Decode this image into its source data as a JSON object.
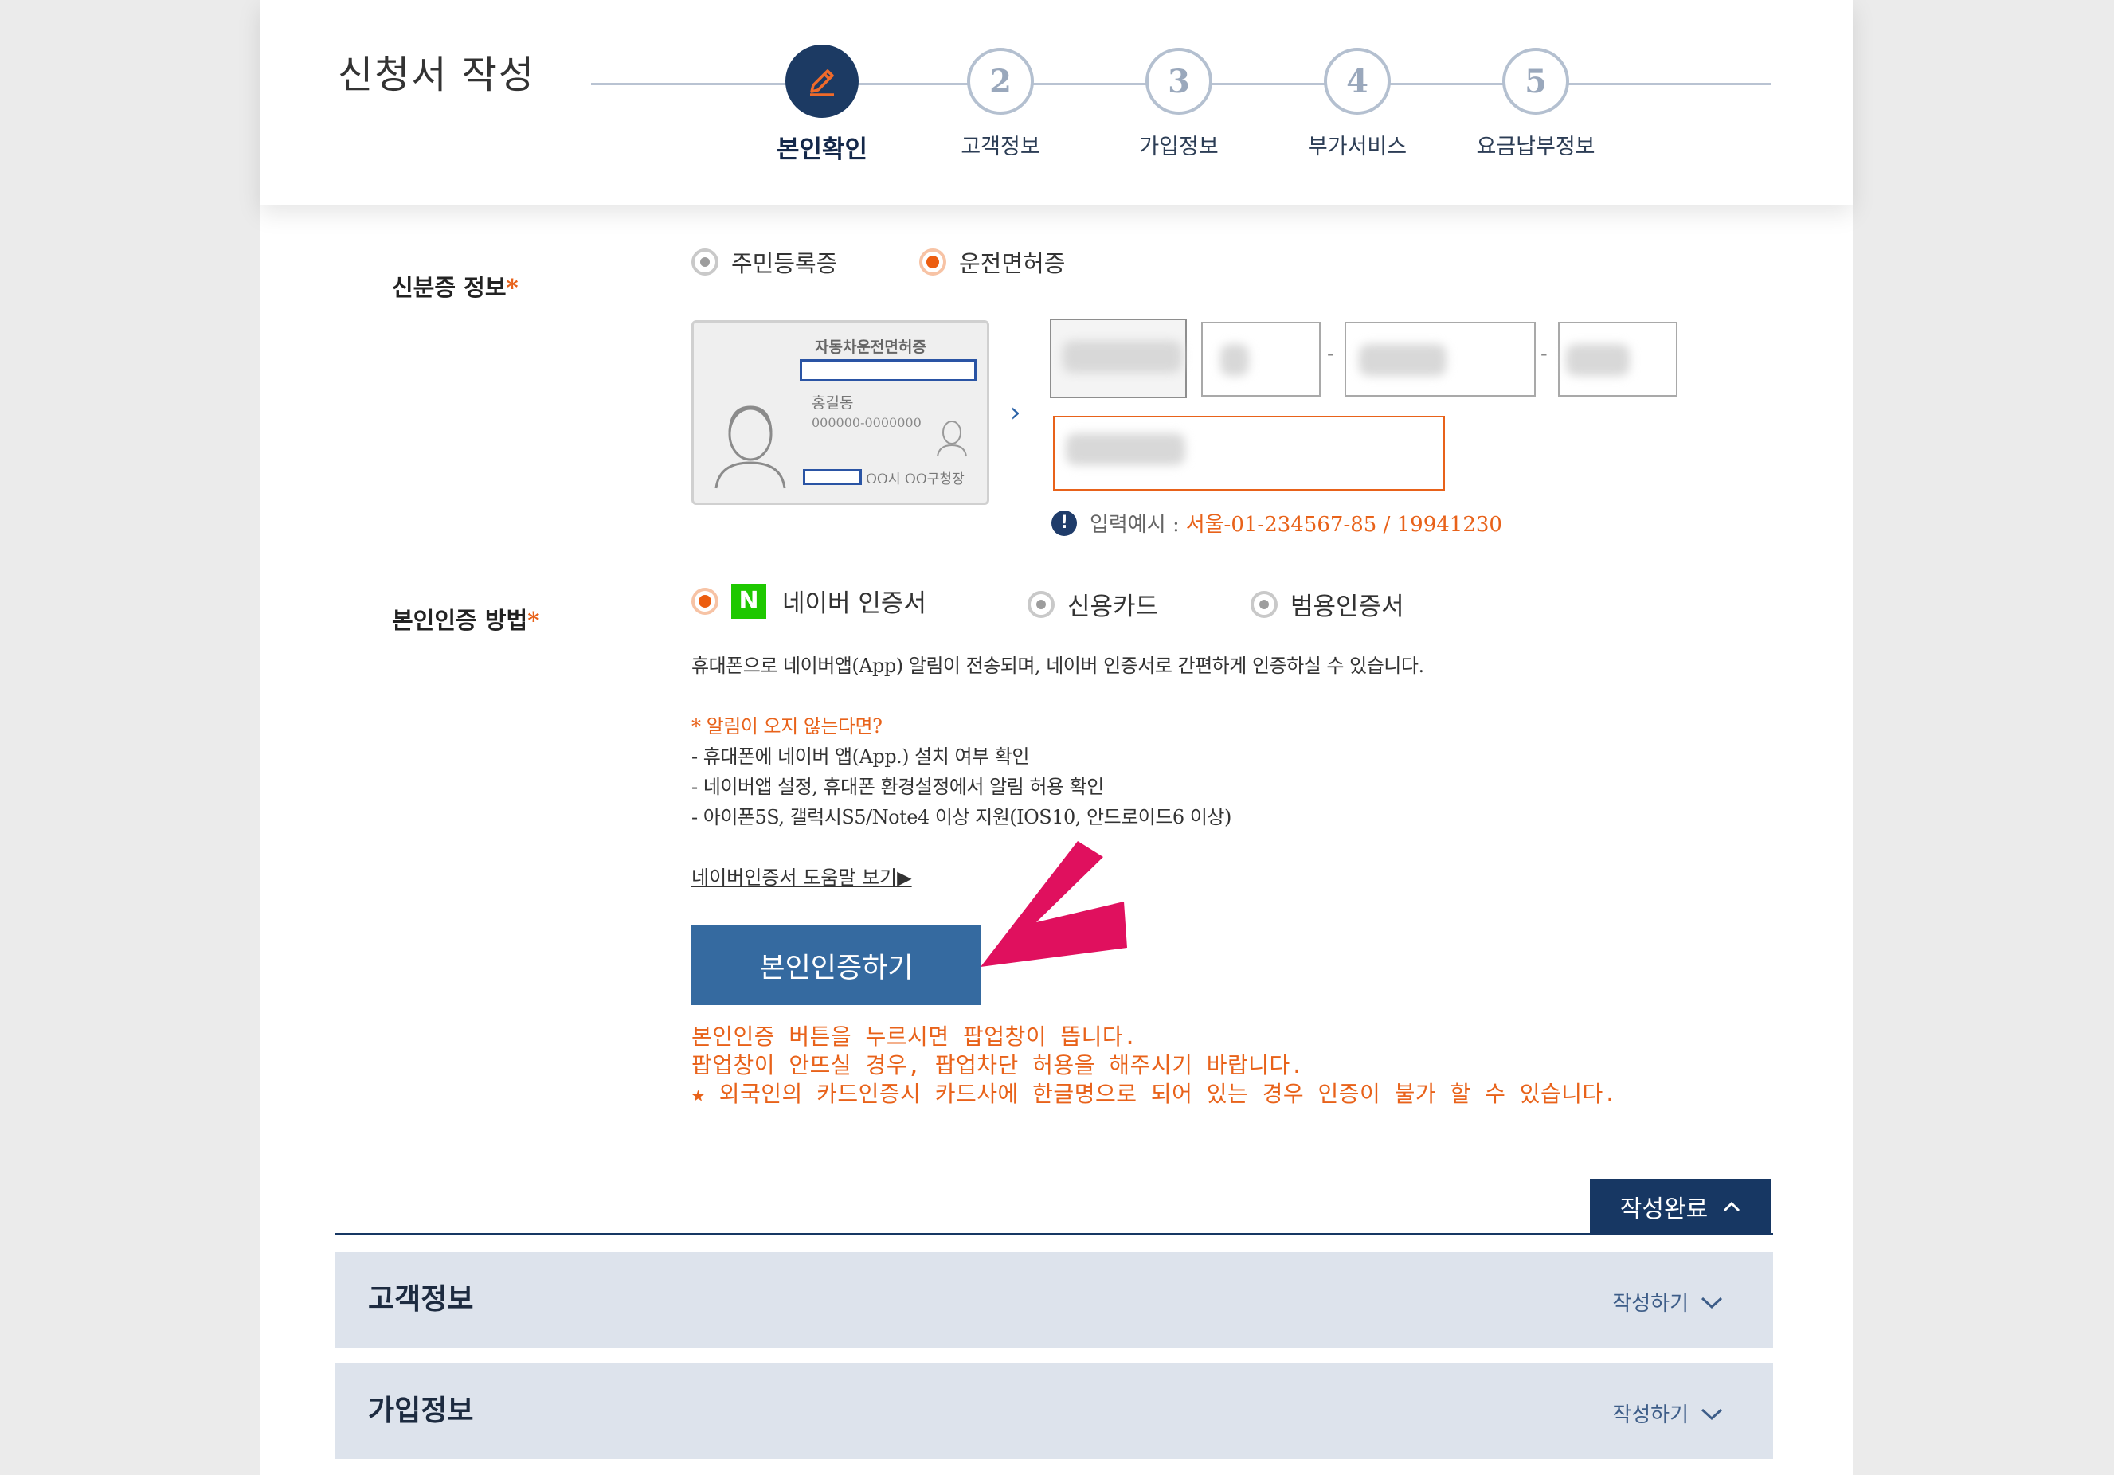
{
  "header": {
    "title": "신청서 작성",
    "steps": [
      {
        "num": "",
        "label": "본인확인",
        "active": true
      },
      {
        "num": "2",
        "label": "고객정보"
      },
      {
        "num": "3",
        "label": "가입정보"
      },
      {
        "num": "4",
        "label": "부가서비스"
      },
      {
        "num": "5",
        "label": "요금납부정보"
      }
    ]
  },
  "id_info": {
    "label": "신분증 정보",
    "required_mark": "*",
    "options": [
      {
        "label": "주민등록증",
        "selected": false
      },
      {
        "label": "운전면허증",
        "selected": true
      }
    ],
    "card": {
      "title": "자동차운전면허증",
      "name": "홍길동",
      "number": "000000-0000000",
      "issuer": "OO시 OO구청장"
    },
    "dash": "-",
    "hint_icon": "!",
    "hint_prefix": "입력예시 :",
    "hint_example": "서울-01-234567-85 / 19941230"
  },
  "auth": {
    "label": "본인인증 방법",
    "required_mark": "*",
    "naver_badge": "N",
    "options": [
      {
        "label": "네이버 인증서",
        "selected": true
      },
      {
        "label": "신용카드",
        "selected": false
      },
      {
        "label": "범용인증서",
        "selected": false
      }
    ],
    "description": "휴대폰으로 네이버앱(App) 알림이 전송되며, 네이버 인증서로 간편하게 인증하실 수 있습니다.",
    "notice_title": "* 알림이 오지 않는다면?",
    "notice_items": [
      "- 휴대폰에 네이버 앱(App.) 설치 여부 확인",
      "- 네이버앱 설정, 휴대폰 환경설정에서 알림 허용 확인",
      "- 아이폰5S, 갤럭시S5/Note4 이상 지원(IOS10, 안드로이드6 이상)"
    ],
    "help_link": "네이버인증서 도움말 보기▶",
    "button": "본인인증하기",
    "warnings": [
      "본인인증 버튼을 누르시면 팝업창이 뜹니다.",
      "팝업창이 안뜨실 경우, 팝업차단 허용을 해주시기 바랍니다.",
      "★ 외국인의 카드인증시 카드사에 한글명으로 되어 있는 경우 인증이 불가 할 수 있습니다."
    ]
  },
  "done_button": "작성완료",
  "sections": [
    {
      "title": "고객정보",
      "action": "작성하기"
    },
    {
      "title": "가입정보",
      "action": "작성하기"
    }
  ],
  "colors": {
    "navy": "#173763",
    "accent_orange": "#e8621a",
    "button_blue": "#356aa0",
    "naver_green": "#1ec800",
    "pointer_pink": "#e0105e"
  },
  "icons": [
    "pencil-icon",
    "exclamation-icon",
    "chevron-right-icon",
    "chevron-up-icon",
    "chevron-down-icon",
    "pointer-arrow-icon"
  ]
}
